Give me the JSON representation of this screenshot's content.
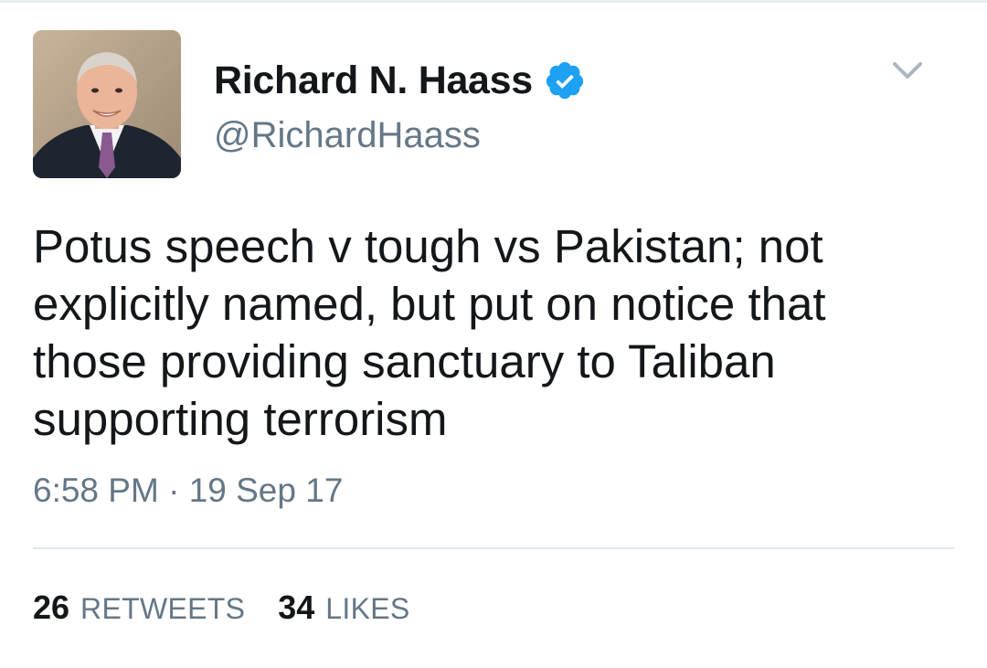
{
  "author": {
    "display_name": "Richard N. Haass",
    "handle": "@RichardHaass",
    "verified": true
  },
  "tweet": {
    "text": "Potus speech v tough vs Pakistan; not\nexplicitly named, but put on notice that\nthose providing sanctuary to Taliban\nsupporting terrorism",
    "time": "6:58 PM",
    "separator": "·",
    "date": "19 Sep 17"
  },
  "stats": {
    "retweets_count": "26",
    "retweets_label": "RETWEETS",
    "likes_count": "34",
    "likes_label": "LIKES"
  },
  "icons": {
    "verified": "verified-badge-icon",
    "menu": "chevron-down-icon"
  },
  "colors": {
    "verified_blue": "#1da1f2",
    "text_primary": "#14171a",
    "text_secondary": "#657786",
    "divider": "#e1e8ed"
  }
}
